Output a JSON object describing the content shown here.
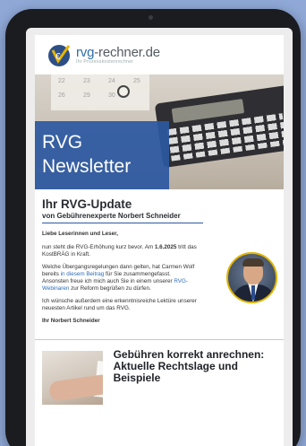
{
  "brand": {
    "logo_main_prefix": "rvg",
    "logo_main_suffix": "-rechner.de",
    "logo_sub": "Ihr Prozesskostenrechner"
  },
  "hero": {
    "title_line1": "RVG",
    "title_line2": "Newsletter",
    "calendar_numbers": [
      "22",
      "23",
      "24",
      "25",
      "26",
      "29",
      "30"
    ]
  },
  "article": {
    "title": "Ihr RVG-Update",
    "subtitle": "von Gebührenexperte Norbert Schneider",
    "greeting": "Liebe Leserinnen und Leser,",
    "p1_a": "nun steht die RVG-Erhöhung kurz bevor. Am ",
    "p1_date": "1.6.2025",
    "p1_b": " tritt das KostBRÄG in Kraft.",
    "p2_a": "Welche Übergangsregelungen dann gelten, hat Carmen Wolf bereits ",
    "p2_link": "in diesem Beitrag",
    "p2_b": " für Sie zusammengefasst.",
    "p2_c": "Ansonsten freue ich mich auch Sie in einem unserer ",
    "p2_link2": "RVG-Webinaren",
    "p2_d": " zur Reform begrüßen zu dürfen.",
    "p3": "Ich wünsche außerdem eine erkenntnisreiche Lektüre unserer neuesten Artikel rund um das RVG.",
    "signature": "Ihr Norbert Schneider"
  },
  "teaser": {
    "title": "Gebühren korrekt anrechnen: Aktuelle Rechtslage und Beispiele"
  },
  "colors": {
    "background": "#8fa8d6",
    "accent_blue": "#2c58a0",
    "link": "#2c6cb5",
    "avatar_ring": "#e0b400"
  }
}
